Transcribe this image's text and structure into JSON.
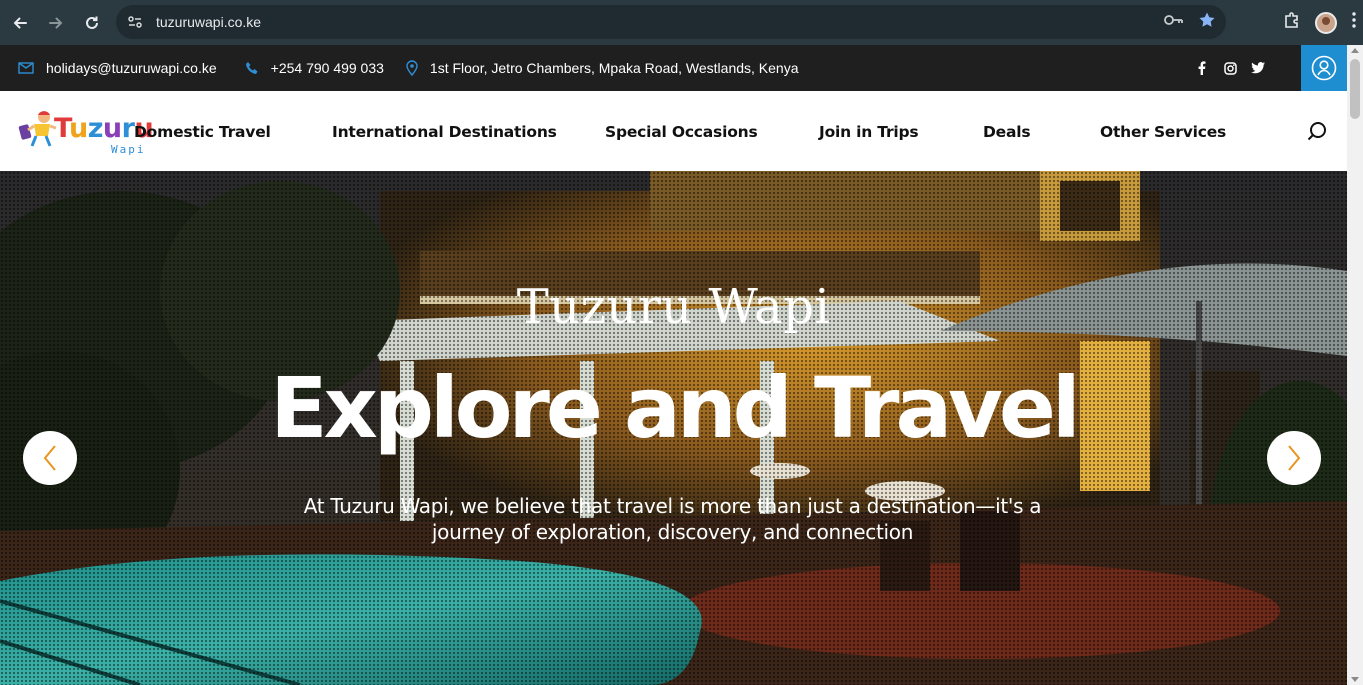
{
  "browser": {
    "url": "tuzuruwapi.co.ke",
    "icons": [
      "back-icon",
      "forward-icon",
      "reload-icon",
      "site-info-icon",
      "key-icon",
      "bookmark-star-icon",
      "extensions-icon",
      "profile-avatar",
      "menu-kebab-icon"
    ]
  },
  "topbar": {
    "email": "holidays@tuzuruwapi.co.ke",
    "phone": "+254 790 499 033",
    "address": "1st Floor, Jetro Chambers, Mpaka Road, Westlands, Kenya",
    "social_icons": [
      "facebook-icon",
      "instagram-icon",
      "twitter-icon"
    ],
    "accent_color": "#1f8ed1"
  },
  "header": {
    "logo": {
      "word": "Tuzuru",
      "sub": "Wapi"
    },
    "menu": [
      {
        "label": "Domestic Travel"
      },
      {
        "label": "International Destinations"
      },
      {
        "label": "Special Occasions"
      },
      {
        "label": "Join in Trips"
      },
      {
        "label": "Deals"
      },
      {
        "label": "Other Services"
      }
    ]
  },
  "hero": {
    "subtitle": "Tuzuru Wapi",
    "title": "Explore and Travel",
    "description": "At Tuzuru Wapi, we believe that travel is more than just a destination—it's a journey of exploration, discovery, and connection",
    "arrow_color": "#e8941f"
  }
}
